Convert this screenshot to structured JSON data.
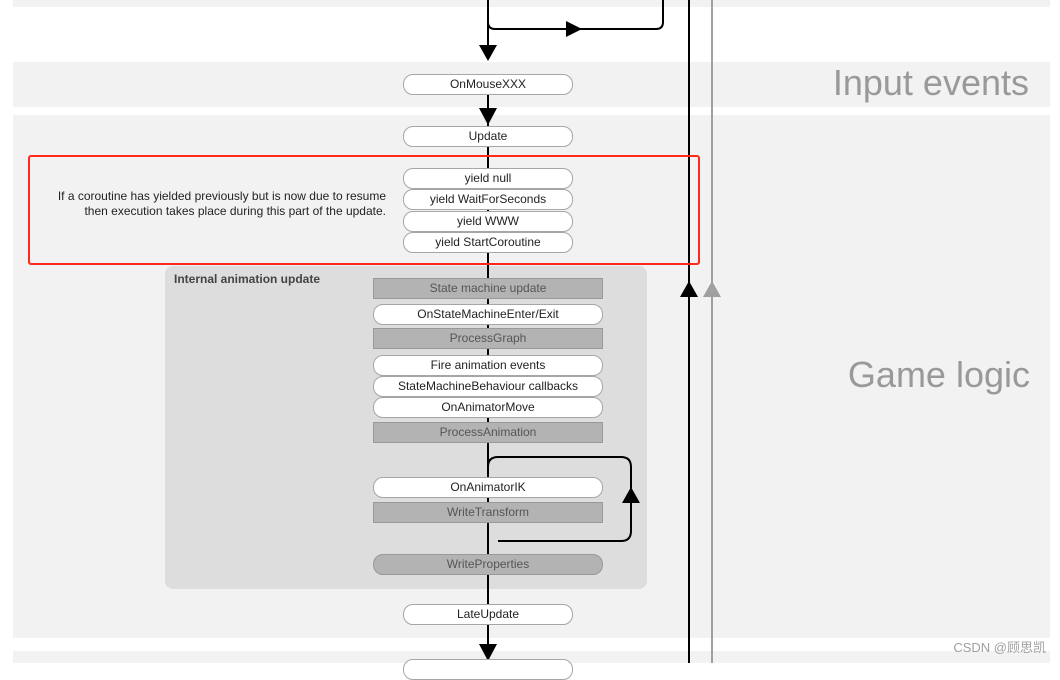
{
  "diagram": {
    "bands": [
      {
        "id": "input-events",
        "title": "Input events"
      },
      {
        "id": "game-logic",
        "title": "Game logic"
      }
    ],
    "input_events_nodes": [
      {
        "label": "OnMouseXXX",
        "style": "pill"
      }
    ],
    "game_logic_nodes": {
      "update": {
        "label": "Update",
        "style": "pill"
      },
      "yield_nodes": [
        {
          "label": "yield null"
        },
        {
          "label": "yield WaitForSeconds"
        },
        {
          "label": "yield WWW"
        },
        {
          "label": "yield StartCoroutine"
        }
      ],
      "coroutine_note": "If a coroutine has yielded previously but is now due to resume then execution takes place during this part of the update.",
      "internal_animation": {
        "title": "Internal animation update",
        "nodes": [
          {
            "label": "State machine update",
            "style": "box"
          },
          {
            "label": "OnStateMachineEnter/Exit",
            "style": "pill"
          },
          {
            "label": "ProcessGraph",
            "style": "box"
          },
          {
            "label": "Fire animation events",
            "style": "pill"
          },
          {
            "label": "StateMachineBehaviour callbacks",
            "style": "pill"
          },
          {
            "label": "OnAnimatorMove",
            "style": "pill"
          },
          {
            "label": "ProcessAnimation",
            "style": "box"
          },
          {
            "label": "OnAnimatorIK",
            "style": "pill"
          },
          {
            "label": "WriteTransform",
            "style": "box"
          },
          {
            "label": "WriteProperties",
            "style": "gpill"
          }
        ]
      },
      "late_update": {
        "label": "LateUpdate",
        "style": "pill"
      }
    },
    "highlight_color": "#ff2a1a",
    "watermark": "CSDN @顾思凯"
  }
}
